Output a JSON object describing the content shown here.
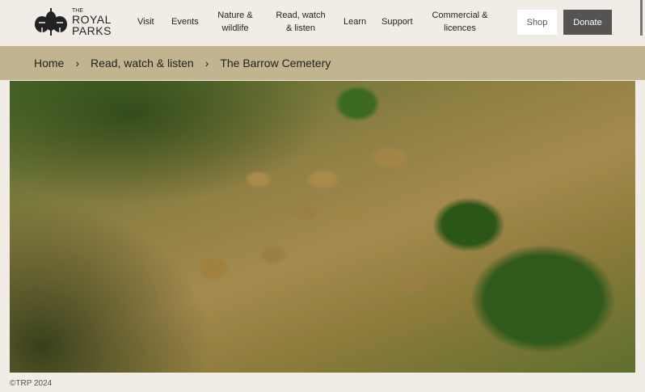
{
  "header": {
    "logo": {
      "the": "THE",
      "line1": "ROYAL",
      "line2": "PARKS"
    },
    "nav": [
      "Visit",
      "Events",
      "Nature &\nwildlife",
      "Read, watch\n& listen",
      "Learn",
      "Support",
      "Commercial &\nlicences"
    ],
    "shop_label": "Shop",
    "donate_label": "Donate"
  },
  "breadcrumb": [
    "Home",
    "Read, watch & listen",
    "The Barrow Cemetery"
  ],
  "footer": {
    "copyright": "©TRP 2024"
  }
}
